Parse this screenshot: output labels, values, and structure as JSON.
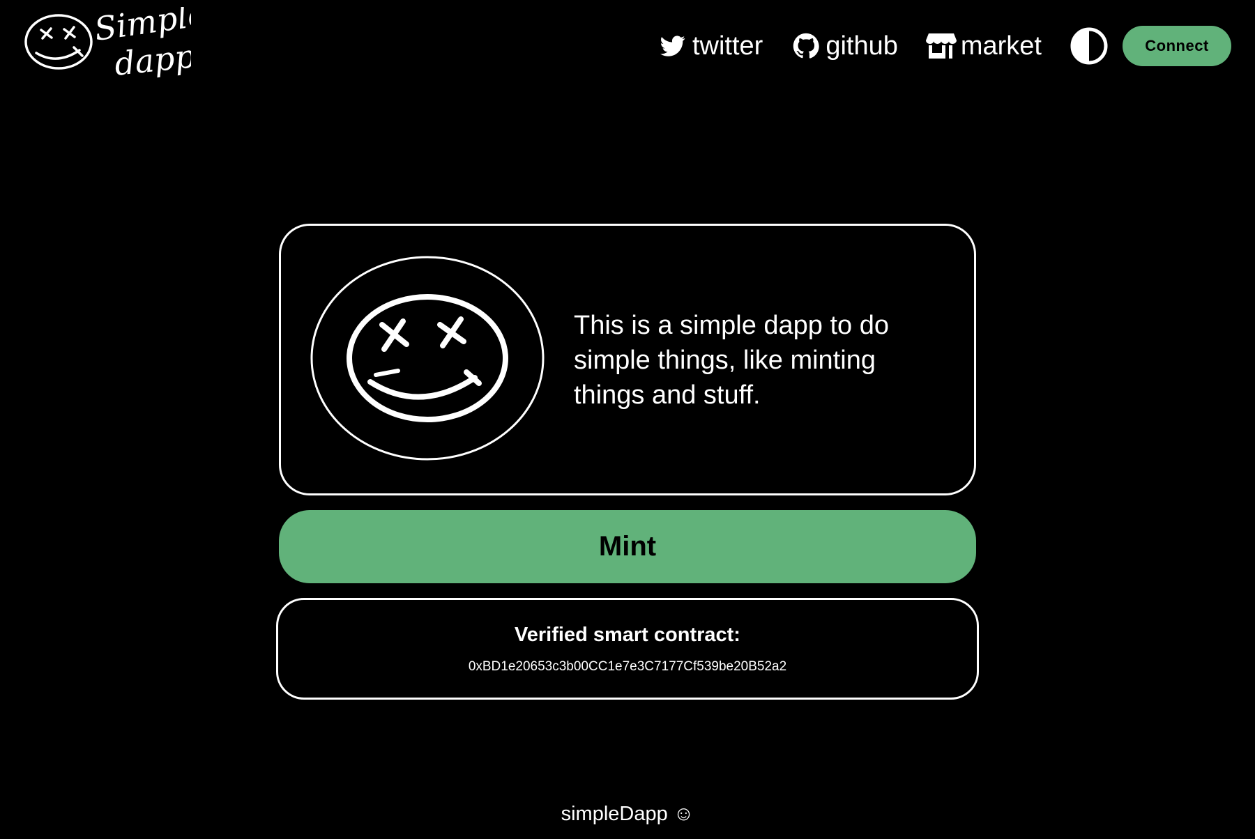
{
  "app": {
    "logo_alt": "simple dapp",
    "logo_line1": "Simple",
    "logo_line2": "dapp"
  },
  "nav": {
    "links": [
      {
        "label": "twitter",
        "icon": "twitter-bird-icon"
      },
      {
        "label": "github",
        "icon": "github-octocat-icon"
      },
      {
        "label": "market",
        "icon": "storefront-icon"
      }
    ],
    "theme_toggle_icon": "contrast-half-circle-icon",
    "connect_label": "Connect"
  },
  "hero": {
    "description": "This is a simple dapp to do simple things, like minting things and stuff.",
    "image_icon": "dizzy-smiley-face-icon"
  },
  "mint": {
    "label": "Mint"
  },
  "contract": {
    "title": "Verified smart contract:",
    "address": "0xBD1e20653c3b00CC1e7e3C7177Cf539be20B52a2"
  },
  "footer": {
    "text": "simpleDapp ☺"
  },
  "colors": {
    "background": "#000000",
    "foreground": "#ffffff",
    "accent_green": "#61b27a"
  }
}
